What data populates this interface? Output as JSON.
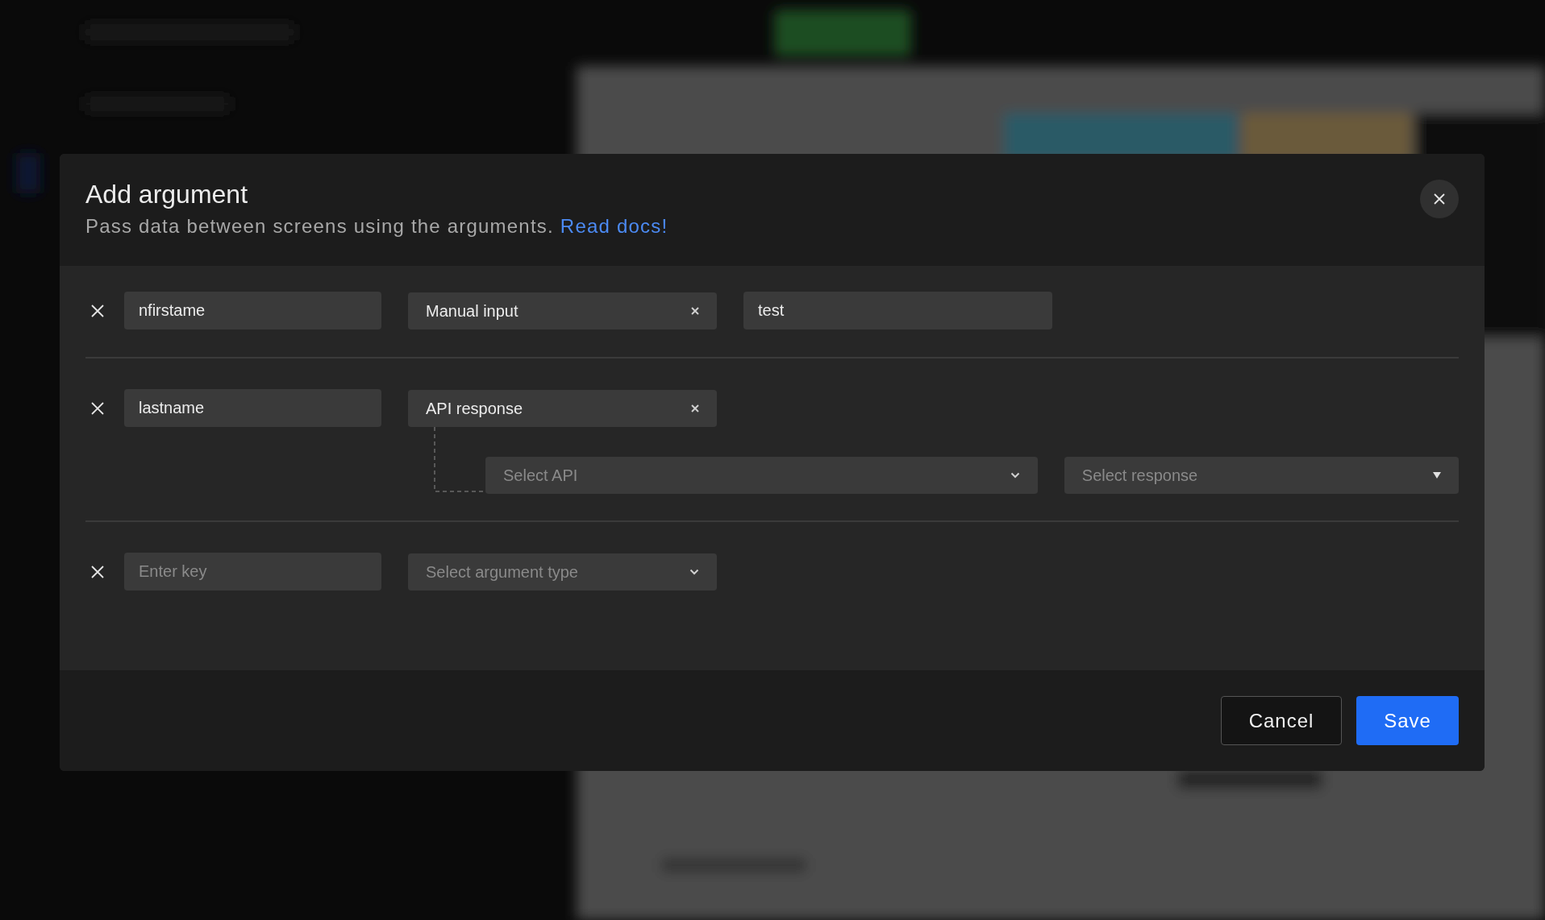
{
  "dialog": {
    "title": "Add argument",
    "subtitle": "Pass data between screens using the arguments.",
    "docs_link": "Read docs!"
  },
  "arguments": [
    {
      "kind": "manual",
      "key": "nfirstame",
      "type": "Manual input",
      "value": "test"
    },
    {
      "kind": "api",
      "key": "lastname",
      "type": "API response",
      "api_placeholder": "Select API",
      "response_placeholder": "Select response"
    },
    {
      "kind": "empty",
      "key_placeholder": "Enter key",
      "type_placeholder": "Select argument type"
    }
  ],
  "buttons": [
    {
      "label": "Cancel",
      "kind": "secondary"
    },
    {
      "label": "Save",
      "kind": "primary"
    }
  ]
}
